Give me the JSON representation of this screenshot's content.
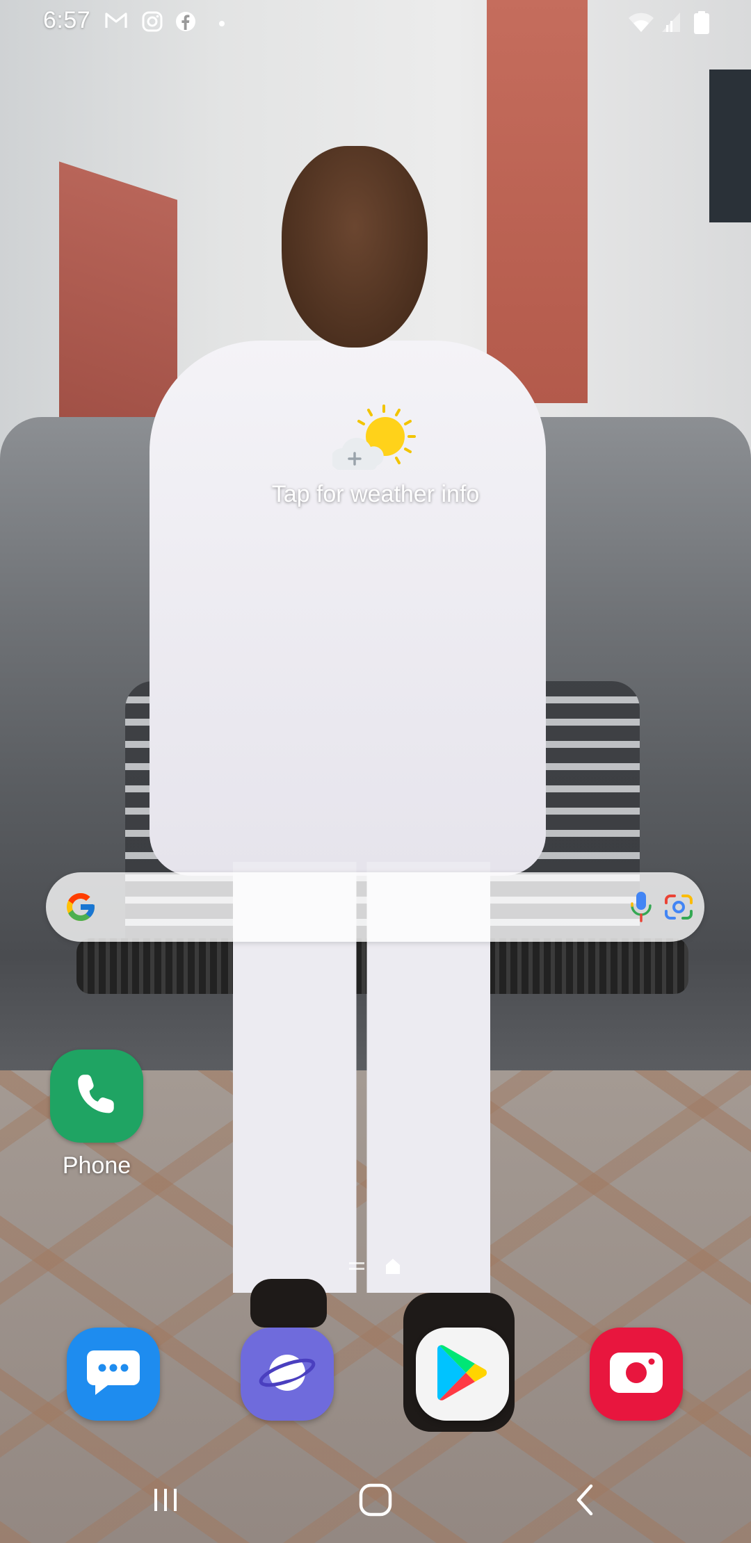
{
  "status_bar": {
    "time": "6:57",
    "notification_icons": [
      "gmail-icon",
      "instagram-icon",
      "facebook-icon",
      "dot-icon"
    ],
    "system_icons": [
      "wifi-icon",
      "signal-icon",
      "battery-icon"
    ]
  },
  "weather_widget": {
    "text": "Tap for weather info",
    "icon": "sun-cloud-icon"
  },
  "search_bar": {
    "logo": "google-icon",
    "actions": [
      "mic-icon",
      "lens-icon"
    ]
  },
  "home_apps": [
    {
      "label": "Phone",
      "icon": "phone-icon",
      "color": "#1fa463"
    }
  ],
  "page_indicator": {
    "icons": [
      "menu-lines-icon",
      "home-indicator-icon"
    ]
  },
  "dock": [
    {
      "name": "Messages",
      "icon": "messages-icon",
      "color": "#1e8cef"
    },
    {
      "name": "Internet",
      "icon": "internet-icon",
      "color": "#6f6bdc"
    },
    {
      "name": "Play Store",
      "icon": "play-store-icon",
      "color": "#f4f4f4"
    },
    {
      "name": "Camera",
      "icon": "camera-icon",
      "color": "#e8163e"
    }
  ],
  "nav_bar": {
    "buttons": [
      "recents-icon",
      "home-icon",
      "back-icon"
    ]
  }
}
